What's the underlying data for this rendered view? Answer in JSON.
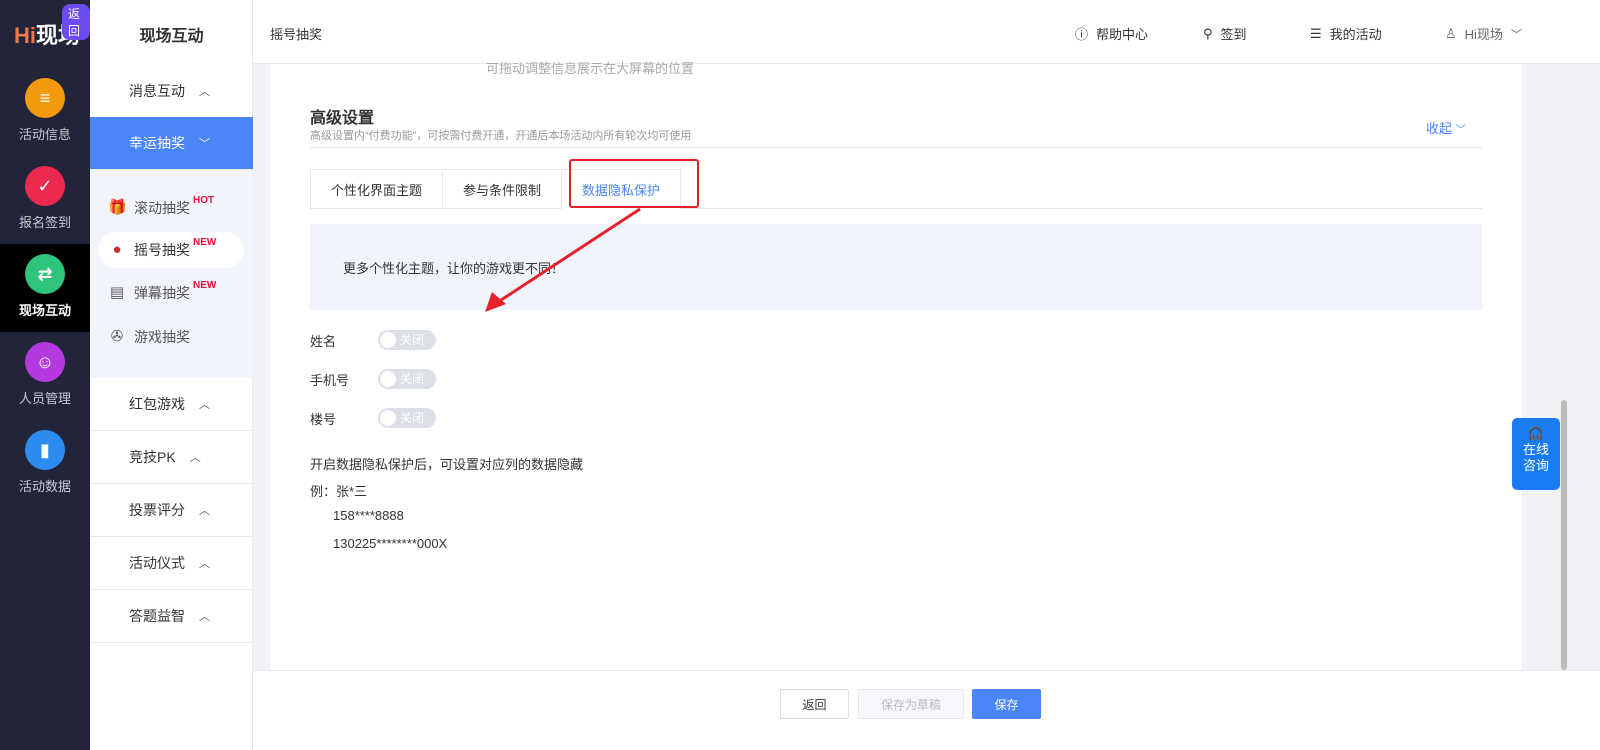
{
  "rail": {
    "logo": "Hi现场",
    "back": "返回",
    "items": [
      {
        "label": "活动信息",
        "color": "#f29a0c",
        "icon": "document-icon"
      },
      {
        "label": "报名签到",
        "color": "#ea2a4e",
        "icon": "calendar-check-icon"
      },
      {
        "label": "现场互动",
        "color": "#2fc47c",
        "icon": "interaction-icon",
        "active": true
      },
      {
        "label": "人员管理",
        "color": "#b43ae0",
        "icon": "person-icon"
      },
      {
        "label": "活动数据",
        "color": "#2d8cf0",
        "icon": "bar-chart-icon"
      }
    ]
  },
  "subnav": {
    "title": "现场互动",
    "groups": [
      "消息互动",
      "幸运抽奖",
      "红包游戏",
      "竞技PK",
      "投票评分",
      "活动仪式",
      "答题益智"
    ],
    "items": [
      {
        "label": "滚动抽奖",
        "badge": "HOT"
      },
      {
        "label": "摇号抽奖",
        "badge": "NEW"
      },
      {
        "label": "弹幕抽奖",
        "badge": "NEW"
      },
      {
        "label": "游戏抽奖",
        "badge": ""
      }
    ]
  },
  "header": {
    "breadcrumb": "摇号抽奖",
    "help": "帮助中心",
    "checkin": "签到",
    "my_activities": "我的活动",
    "user": "Hi现场"
  },
  "content": {
    "faint_text": "可拖动调整信息展示在大屏幕的位置",
    "section_title": "高级设置",
    "section_desc": "高级设置内“付费功能”，可按需付费开通，开通后本场活动内所有轮次均可使用",
    "collapse": "收起",
    "tabs": [
      "个性化界面主题",
      "参与条件限制",
      "数据隐私保护"
    ],
    "banner": "更多个性化主题，让你的游戏更不同！",
    "fields": [
      {
        "label": "姓名",
        "state": "关闭"
      },
      {
        "label": "手机号",
        "state": "关闭"
      },
      {
        "label": "楼号",
        "state": "关闭"
      }
    ],
    "note": "开启数据隐私保护后，可设置对应列的数据隐藏",
    "example": "例：张*三",
    "ex_phone": "158****8888",
    "ex_id": "130225********000X"
  },
  "footer": {
    "back": "返回",
    "draft": "保存为草稿",
    "save": "保存"
  },
  "chat": {
    "line1": "在线",
    "line2": "咨询"
  }
}
